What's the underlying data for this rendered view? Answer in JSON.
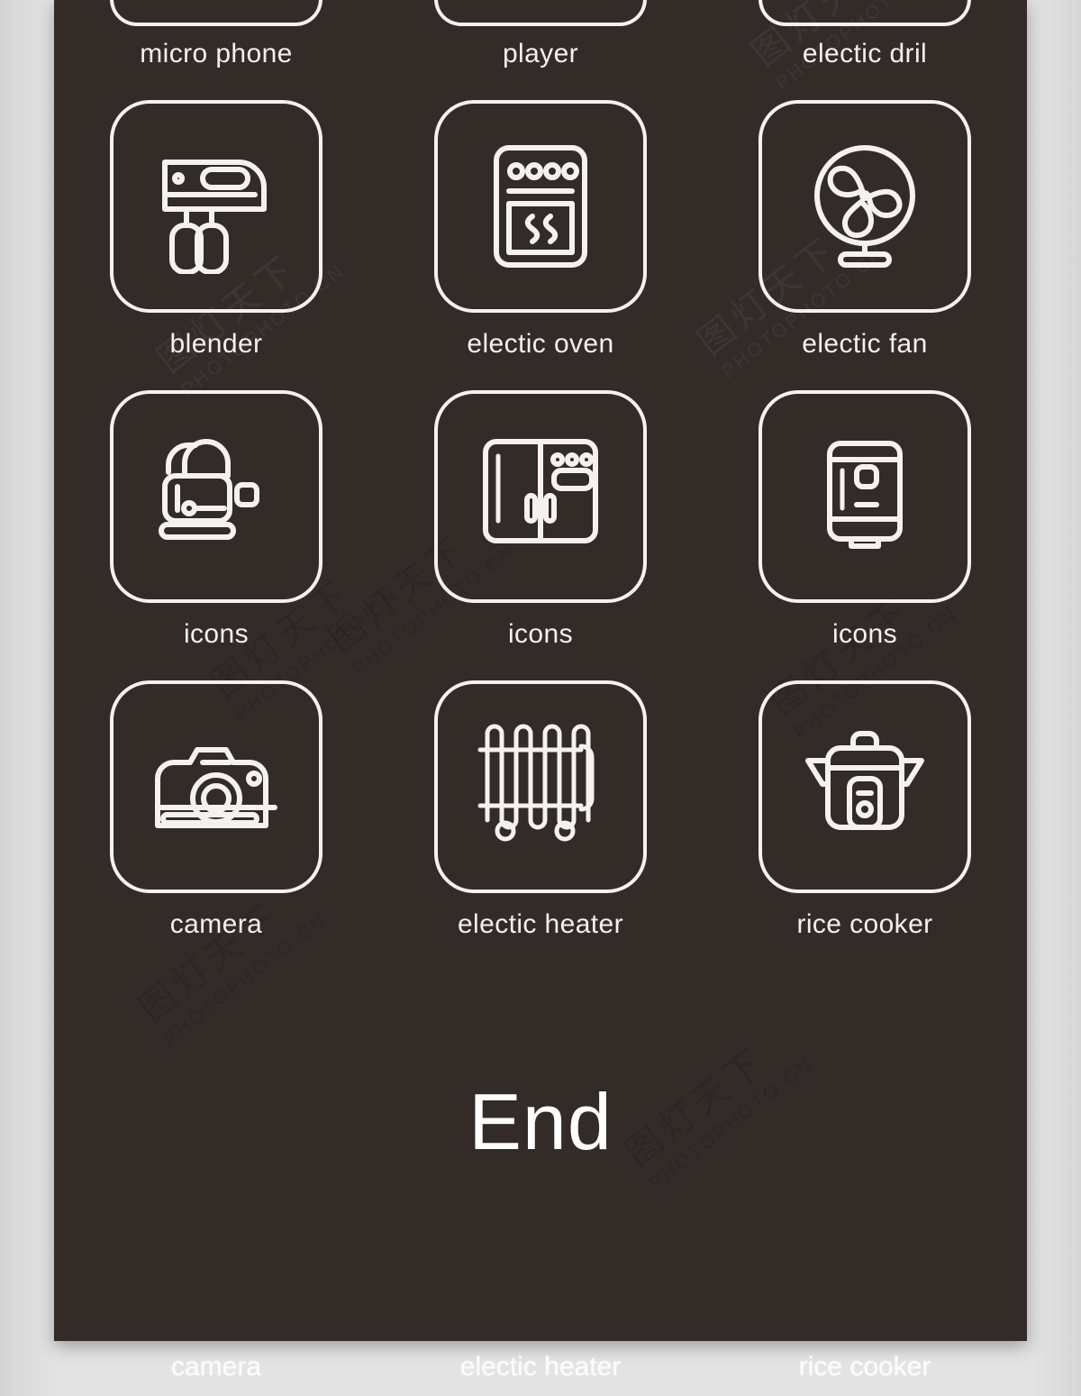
{
  "app": {
    "panel_background": "#332b28",
    "page_background": "#e2e2e2",
    "stroke_color": "#f4f1ee"
  },
  "grid": {
    "rows": [
      {
        "clipped": true,
        "cells": [
          {
            "icon": "microphone-icon",
            "label": "micro phone"
          },
          {
            "icon": "player-icon",
            "label": "player"
          },
          {
            "icon": "electric-drill-icon",
            "label": "electic dril"
          }
        ]
      },
      {
        "clipped": false,
        "cells": [
          {
            "icon": "blender-icon",
            "label": "blender"
          },
          {
            "icon": "electric-oven-icon",
            "label": "electic oven"
          },
          {
            "icon": "electric-fan-icon",
            "label": "electic fan"
          }
        ]
      },
      {
        "clipped": false,
        "cells": [
          {
            "icon": "toaster-icon",
            "label": "icons"
          },
          {
            "icon": "refrigerator-icon",
            "label": "icons"
          },
          {
            "icon": "water-heater-icon",
            "label": "icons"
          }
        ]
      },
      {
        "clipped": false,
        "cells": [
          {
            "icon": "camera-icon",
            "label": "camera"
          },
          {
            "icon": "electric-heater-icon",
            "label": "electic heater"
          },
          {
            "icon": "rice-cooker-icon",
            "label": "rice cooker"
          }
        ]
      }
    ]
  },
  "end": {
    "text": "End"
  },
  "ghost_labels": [
    "camera",
    "electic heater",
    "rice cooker"
  ],
  "watermark": {
    "cjk": "图灯天下",
    "latin": "PHOTOPHOTO.CN"
  }
}
